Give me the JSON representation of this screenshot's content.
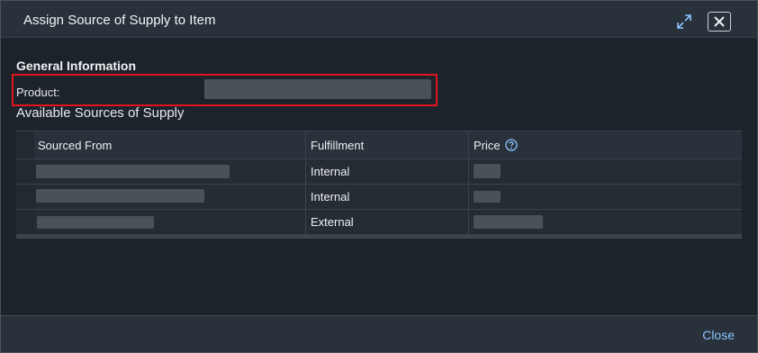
{
  "dialog": {
    "title": "Assign Source of Supply to Item",
    "icons": {
      "expand": "expand-icon",
      "close": "close-icon"
    }
  },
  "general": {
    "heading": "General Information",
    "product_label": "Product:"
  },
  "sources": {
    "heading": "Available Sources of Supply",
    "columns": [
      "Sourced From",
      "Fulfillment",
      "Price"
    ],
    "price_help_icon": "help-circle-icon",
    "rows": [
      {
        "fulfillment": "Internal"
      },
      {
        "fulfillment": "Internal"
      },
      {
        "fulfillment": "External"
      }
    ]
  },
  "footer": {
    "close_label": "Close"
  },
  "colors": {
    "accent_link": "#8cc4ff",
    "highlight": "#e0141e",
    "background": "#1d232a"
  }
}
